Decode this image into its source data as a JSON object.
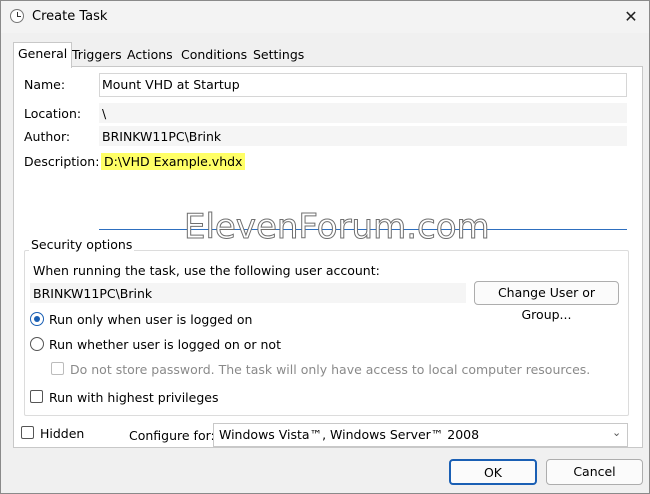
{
  "window": {
    "title": "Create Task",
    "close_glyph": "✕"
  },
  "tabs": [
    {
      "label": "General",
      "active": true
    },
    {
      "label": "Triggers"
    },
    {
      "label": "Actions"
    },
    {
      "label": "Conditions"
    },
    {
      "label": "Settings"
    }
  ],
  "general": {
    "name_label": "Name:",
    "name_value": "Mount VHD at Startup",
    "location_label": "Location:",
    "location_value": "\\",
    "author_label": "Author:",
    "author_value": "BRINKW11PC\\Brink",
    "description_label": "Description:",
    "description_value": "D:\\VHD Example.vhdx"
  },
  "security": {
    "group_title": "Security options",
    "account_prompt": "When running the task, use the following user account:",
    "account_value": "BRINKW11PC\\Brink",
    "change_button": "Change User or Group...",
    "radio_logged_on": "Run only when user is logged on",
    "radio_whether": "Run whether user is logged on or not",
    "no_store_password": "Do not store password.  The task will only have access to local computer resources.",
    "highest_privileges": "Run with highest privileges"
  },
  "footer": {
    "hidden_label": "Hidden",
    "configure_label": "Configure for:",
    "configure_value": "Windows Vista™, Windows Server™ 2008",
    "ok_button": "OK",
    "cancel_button": "Cancel"
  },
  "watermark": "ElevenForum.com"
}
